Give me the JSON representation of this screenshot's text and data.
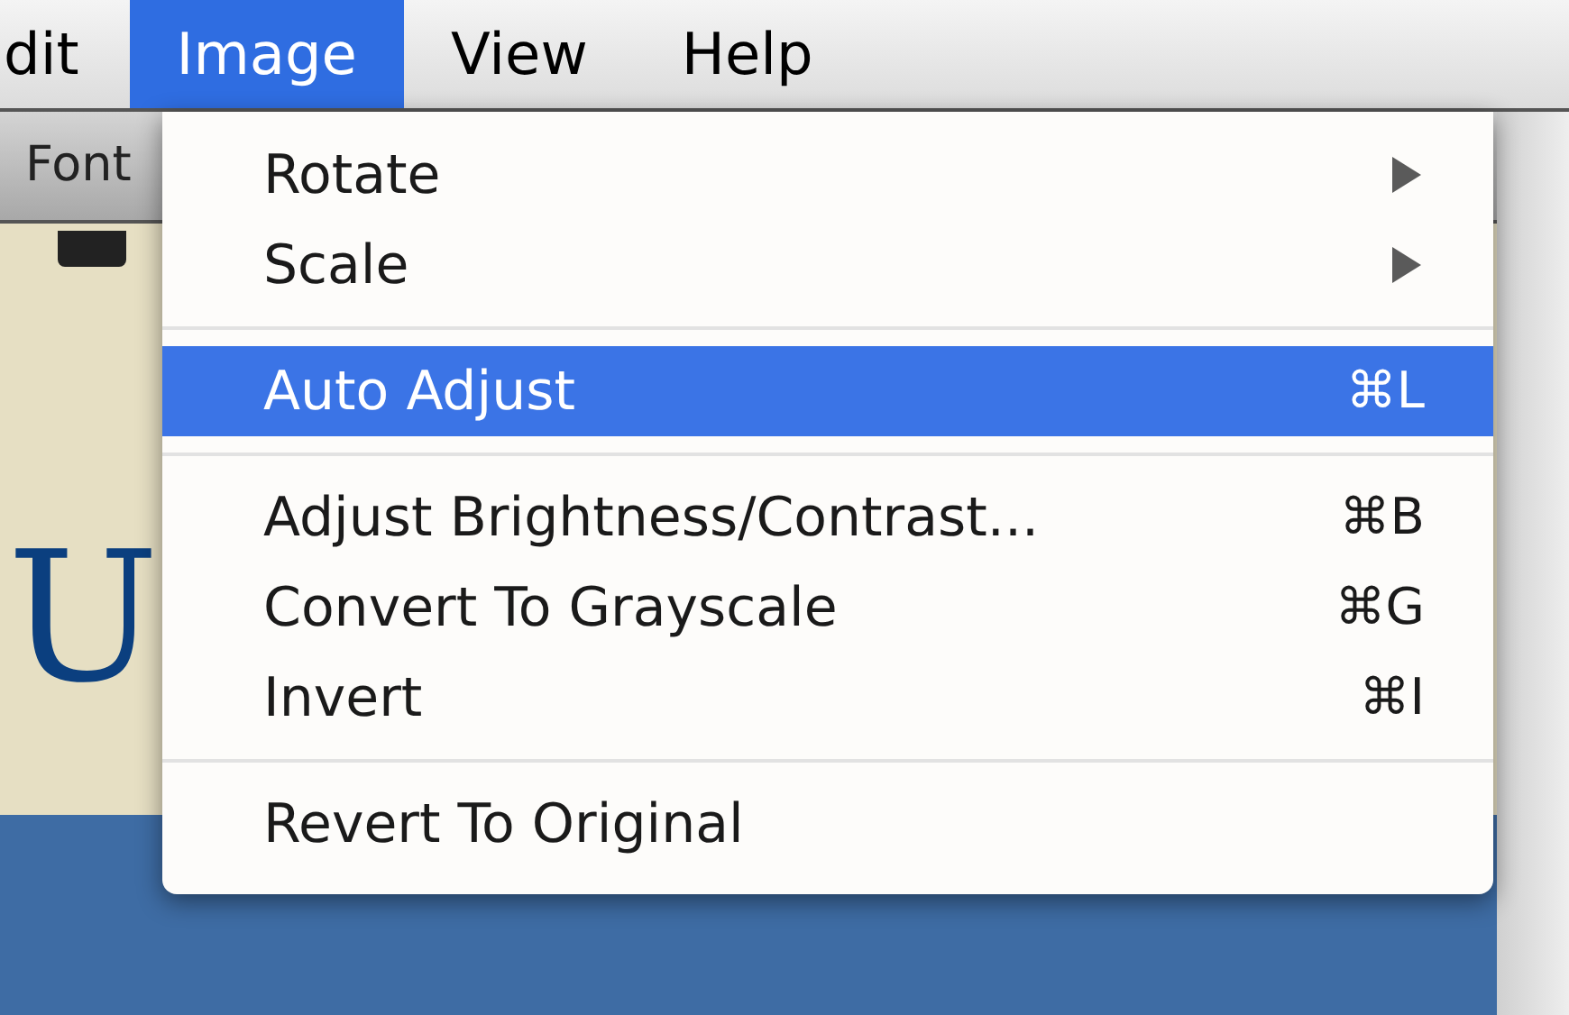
{
  "menubar": [
    {
      "label": "dit",
      "selected": false
    },
    {
      "label": "Image",
      "selected": true
    },
    {
      "label": "View",
      "selected": false
    },
    {
      "label": "Help",
      "selected": false
    }
  ],
  "toolbar": {
    "label": "Font"
  },
  "document": {
    "letter": "U"
  },
  "menu": [
    {
      "kind": "submenu",
      "label": "Rotate",
      "selected": false
    },
    {
      "kind": "submenu",
      "label": "Scale",
      "selected": false
    },
    {
      "kind": "separator"
    },
    {
      "kind": "item",
      "label": "Auto Adjust",
      "shortcut": "⌘L",
      "selected": true
    },
    {
      "kind": "separator"
    },
    {
      "kind": "item",
      "label": "Adjust Brightness/Contrast...",
      "shortcut": "⌘B",
      "selected": false
    },
    {
      "kind": "item",
      "label": "Convert To Grayscale",
      "shortcut": "⌘G",
      "selected": false
    },
    {
      "kind": "item",
      "label": "Invert",
      "shortcut": "⌘I",
      "selected": false
    },
    {
      "kind": "separator"
    },
    {
      "kind": "item",
      "label": "Revert To Original",
      "selected": false
    }
  ]
}
